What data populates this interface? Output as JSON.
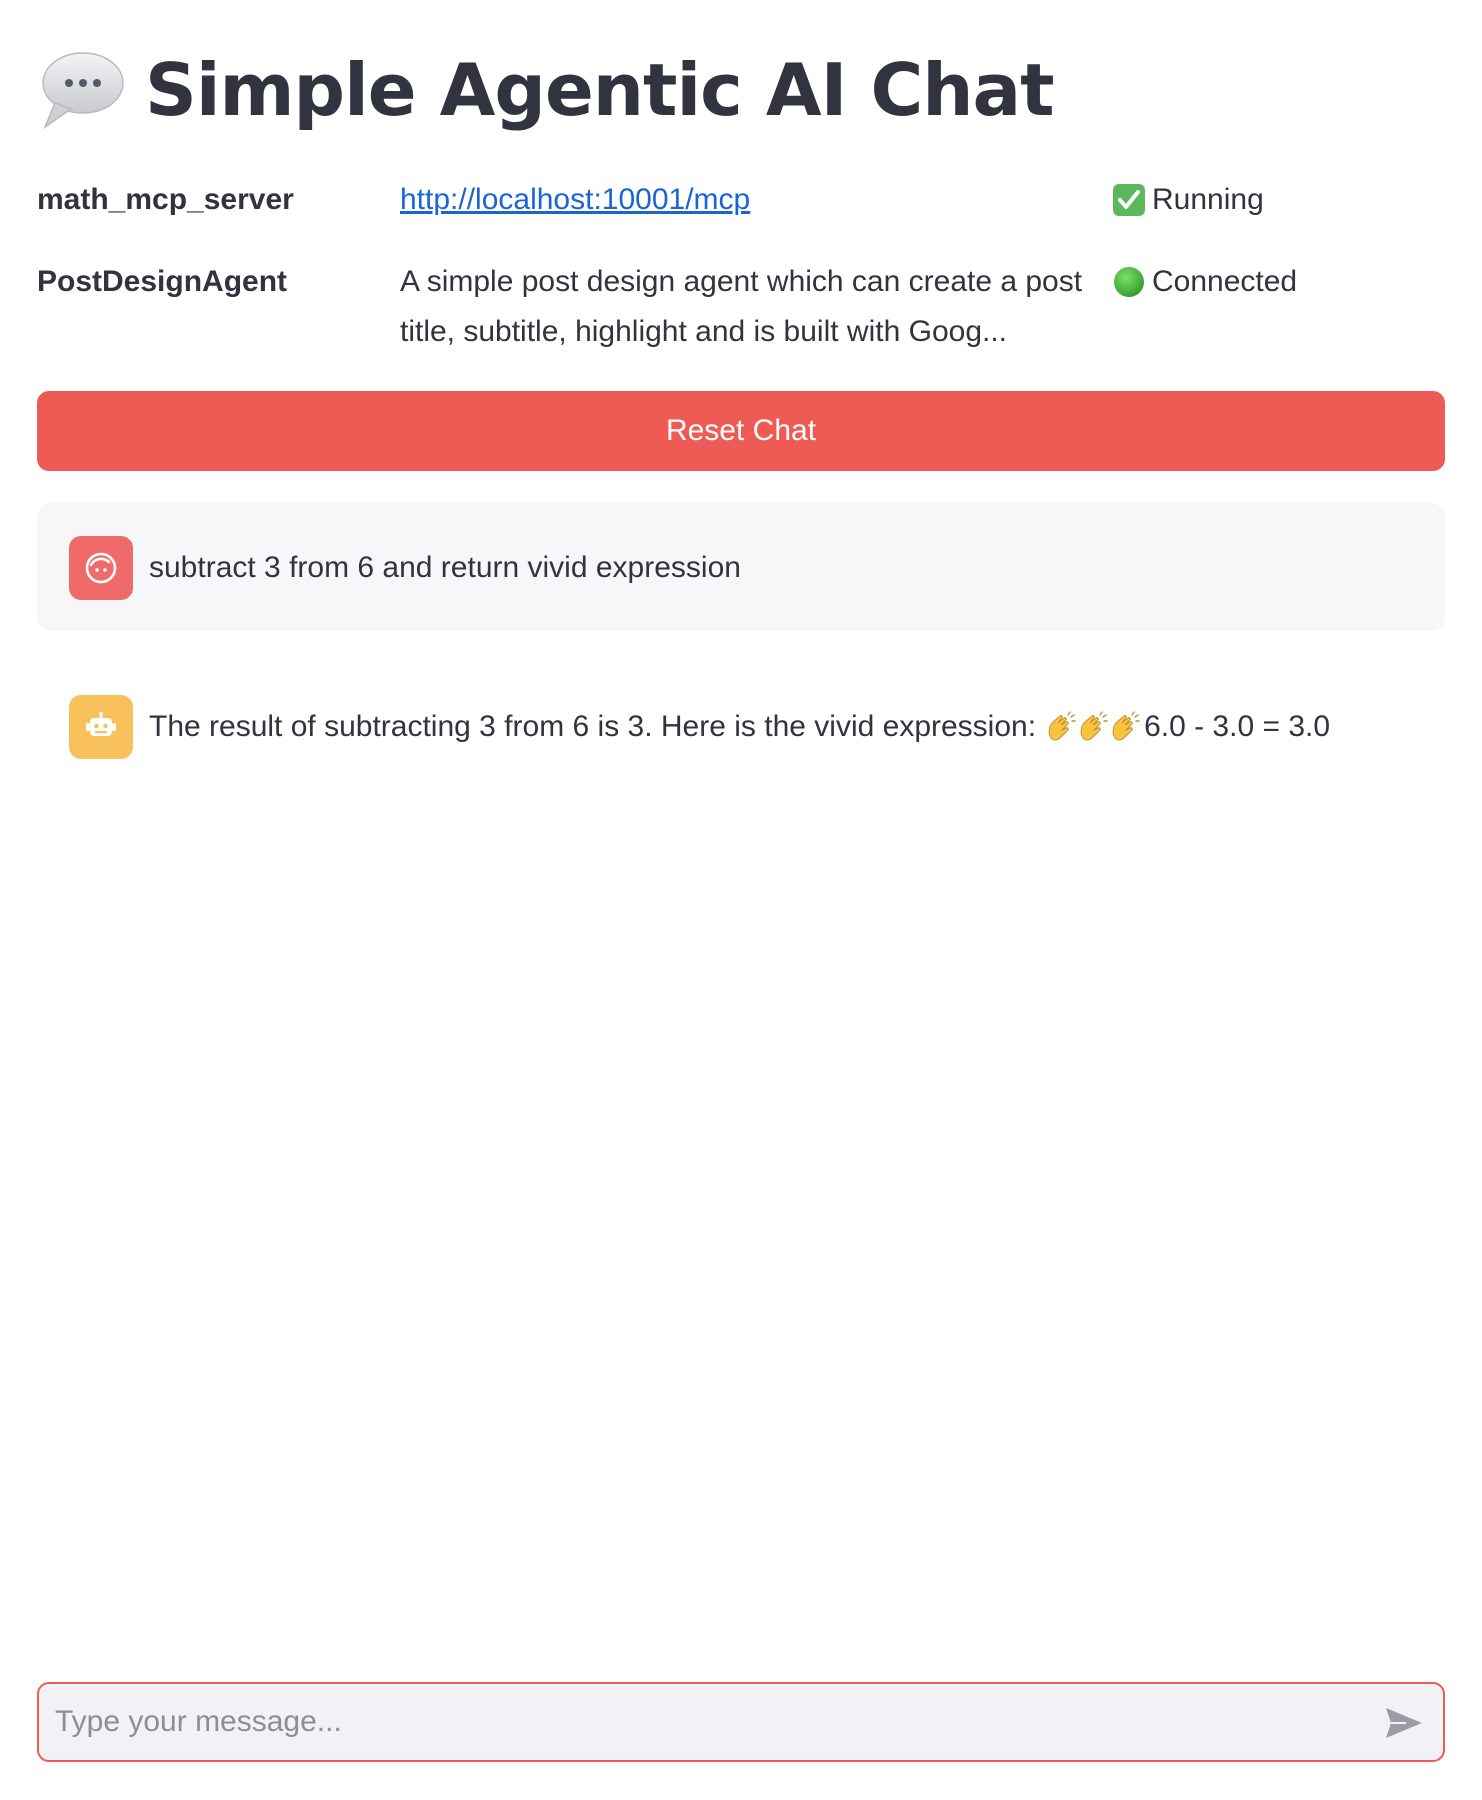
{
  "header": {
    "title": "Simple Agentic AI Chat",
    "title_icon": "speech-bubble-icon"
  },
  "servers": [
    {
      "name": "math_mcp_server",
      "detail": "http://localhost:10001/mcp",
      "status_icon": "check-mark-icon",
      "status": "Running"
    },
    {
      "name": "PostDesignAgent",
      "detail": "A simple post design agent which can create a post title, subtitle, highlight and is built with Goog...",
      "status_icon": "green-circle-icon",
      "status": "Connected"
    }
  ],
  "reset_button": {
    "label": "Reset Chat",
    "color": "#ee5b55"
  },
  "messages": [
    {
      "role": "user",
      "avatar_icon": "user-face-icon",
      "text": "subtract 3 from 6 and return vivid expression"
    },
    {
      "role": "assistant",
      "avatar_icon": "robot-icon",
      "text_before": "The result of subtracting 3 from 6 is 3. Here is the vivid expression:",
      "emoji": "👏👏👏",
      "text_after": "6.0 - 3.0 = 3.0"
    }
  ],
  "input": {
    "placeholder": "Type your message...",
    "value": ""
  },
  "colors": {
    "accent": "#ee5b55",
    "link": "#1c64d6",
    "user_avatar": "#ef6b6b",
    "bot_avatar": "#f8c15c"
  }
}
